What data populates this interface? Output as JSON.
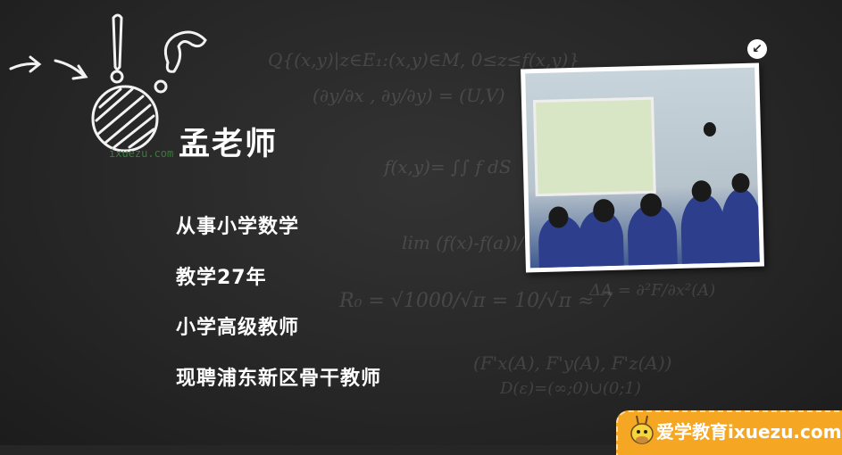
{
  "teacher": {
    "name": "孟老师",
    "details": [
      "从事小学数学",
      "教学27年",
      "小学高级教师",
      "现聘浦东新区骨干教师"
    ]
  },
  "watermark": "ixuezu.com",
  "brand_badge": {
    "text": "爱学教育ixuezu.com",
    "color": "#f5a623"
  },
  "collapse_icon": "arrow-down-left-icon",
  "background_formulas": [
    "Q{(x,y)|z∈E₁:(x,y)∈M, 0≤z≤f(x,y)}",
    "(∂y/∂x , ∂y/∂y) = (U,V)",
    "f(x,y)= ∫∫ f dS",
    "lim (f(x)-f(a))/(x-a)",
    "R₀ = √1000/√π = 10/√π ≈ 7",
    "ΔA = ∂²F/∂x²(A)",
    "(F'x(A), F'y(A), F'z(A))",
    "D(ε)=(∞;0)∪(0;1)"
  ]
}
